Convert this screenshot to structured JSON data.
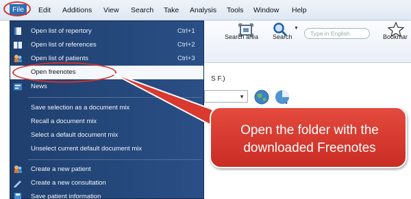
{
  "menubar": {
    "items": [
      "File",
      "Edit",
      "Additions",
      "View",
      "Search",
      "Take",
      "Analysis",
      "Tools",
      "Window",
      "Help"
    ]
  },
  "toolbar": {
    "search_area_label": "Search area",
    "search_label": "Search",
    "search_placeholder": "Type in English",
    "bookmark_label": "Bookmar"
  },
  "background": {
    "fragment_text": "S F.)"
  },
  "file_menu": {
    "items": [
      {
        "label": "Open list of repertory",
        "shortcut": "Ctrl+1",
        "icon": "repertory-book-icon"
      },
      {
        "label": "Open list of references",
        "shortcut": "Ctrl+2",
        "icon": "references-book-icon"
      },
      {
        "label": "Open list of patients",
        "shortcut": "Ctrl+3",
        "icon": "patients-icon"
      },
      {
        "label": "Open freenotes",
        "shortcut": "",
        "icon": "",
        "highlighted": true
      },
      {
        "label": "News",
        "shortcut": "",
        "icon": "news-icon"
      },
      {
        "label": "Save selection as a document mix",
        "shortcut": "",
        "icon": ""
      },
      {
        "label": "Recall a document mix",
        "shortcut": "",
        "icon": ""
      },
      {
        "label": "Select a default document mix",
        "shortcut": "",
        "icon": ""
      },
      {
        "label": "Unselect current default document mix",
        "shortcut": "",
        "icon": ""
      },
      {
        "label": "Create a new patient",
        "shortcut": "",
        "icon": "new-patient-icon"
      },
      {
        "label": "Create a new consultation",
        "shortcut": "",
        "icon": "new-consultation-icon"
      },
      {
        "label": "Save patient information",
        "shortcut": "",
        "icon": "save-icon"
      }
    ]
  },
  "callout": {
    "line1": "Open the folder with the",
    "line2": "downloaded Freenotes"
  },
  "colors": {
    "menu_bg": "#2a4f86",
    "highlight_bg": "#f4f7fc",
    "annotation_red": "#d4312c",
    "callout_bg": "#e44a3e"
  }
}
